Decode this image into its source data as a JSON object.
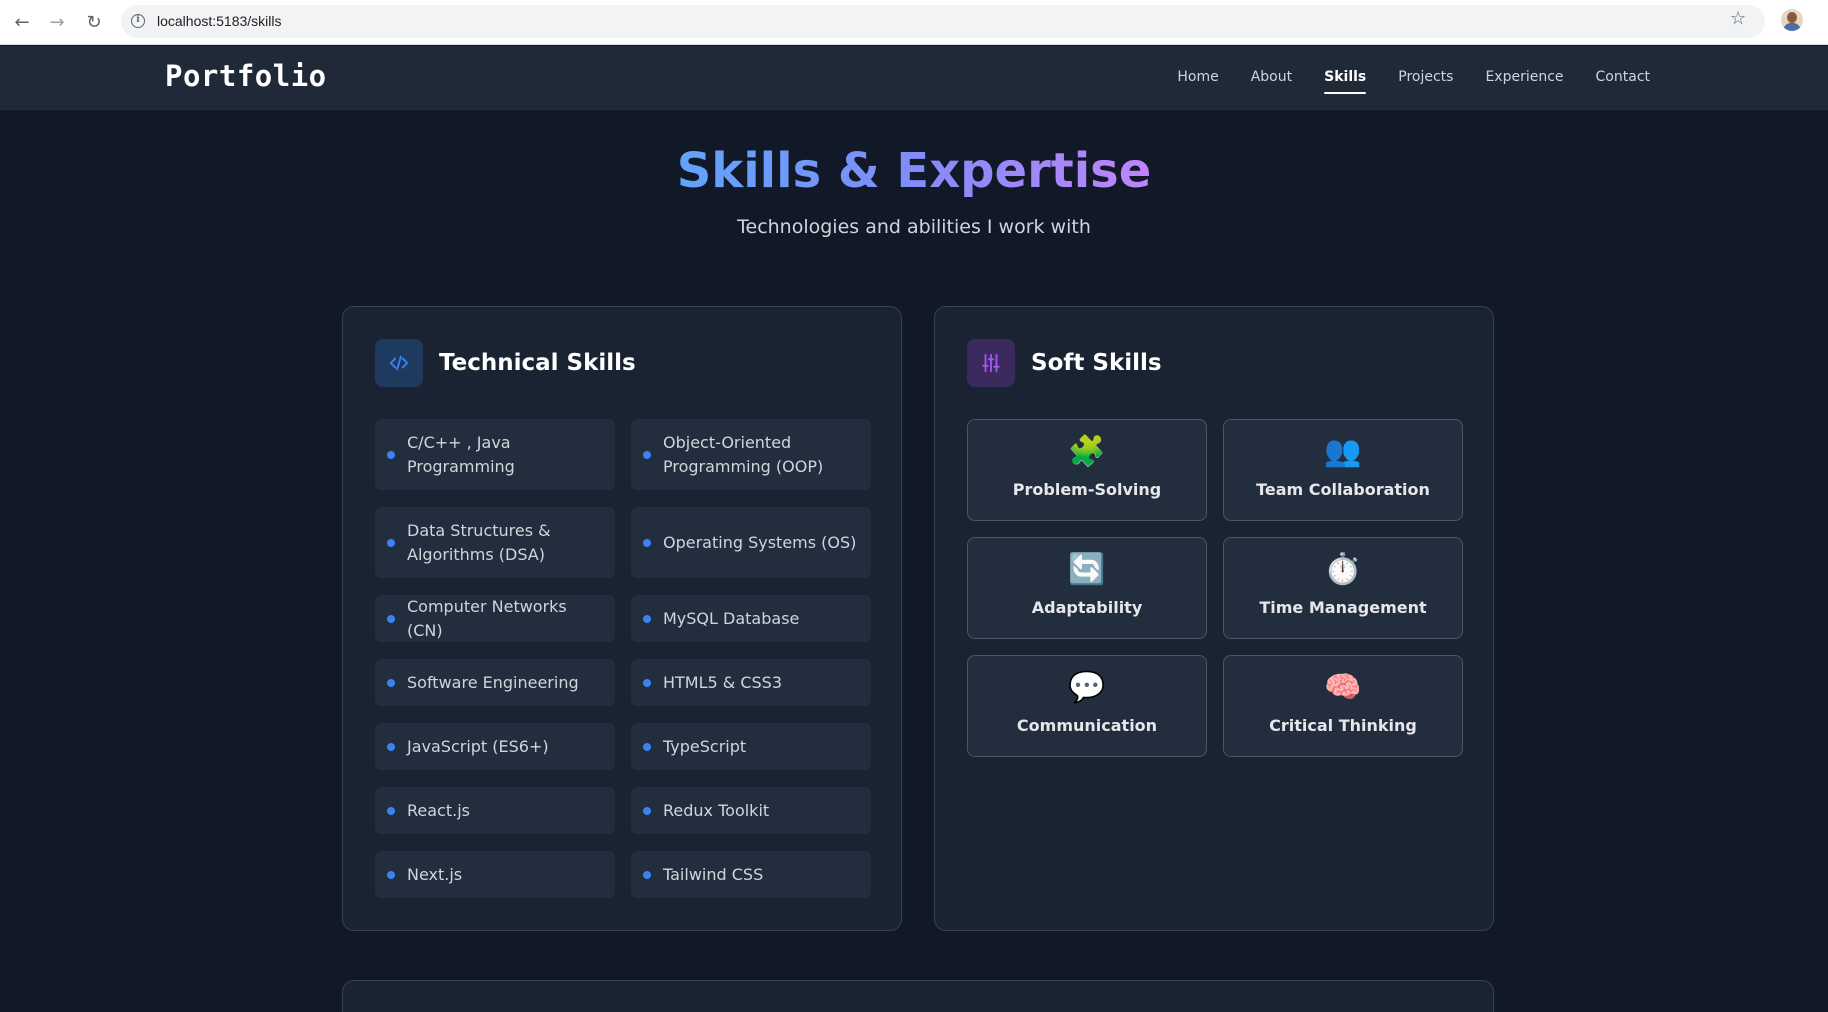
{
  "browser": {
    "url": "localhost:5183/skills"
  },
  "site": {
    "logo": "Portfolio",
    "nav": [
      {
        "label": "Home",
        "active": false
      },
      {
        "label": "About",
        "active": false
      },
      {
        "label": "Skills",
        "active": true
      },
      {
        "label": "Projects",
        "active": false
      },
      {
        "label": "Experience",
        "active": false
      },
      {
        "label": "Contact",
        "active": false
      }
    ]
  },
  "hero": {
    "title": "Skills & Expertise",
    "subtitle": "Technologies and abilities I work with"
  },
  "technical": {
    "title": "Technical Skills",
    "icon": "code-icon",
    "accent": "#3b82f6",
    "items": [
      "C/C++ , Java Programming",
      "Object-Oriented Programming (OOP)",
      "Data Structures & Algorithms (DSA)",
      "Operating Systems (OS)",
      "Computer Networks (CN)",
      "MySQL Database",
      "Software Engineering",
      "HTML5 & CSS3",
      "JavaScript (ES6+)",
      "TypeScript",
      "React.js",
      "Redux Toolkit",
      "Next.js",
      "Tailwind CSS"
    ]
  },
  "soft": {
    "title": "Soft Skills",
    "icon": "sliders-icon",
    "accent": "#a855f7",
    "items": [
      {
        "emoji": "🧩",
        "icon": "puzzle-icon",
        "label": "Problem-Solving"
      },
      {
        "emoji": "👥",
        "icon": "people-icon",
        "label": "Team Collaboration"
      },
      {
        "emoji": "🔄",
        "icon": "cycle-icon",
        "label": "Adaptability"
      },
      {
        "emoji": "⏱️",
        "icon": "stopwatch-icon",
        "label": "Time Management"
      },
      {
        "emoji": "💬",
        "icon": "speech-bubble-icon",
        "label": "Communication"
      },
      {
        "emoji": "🧠",
        "icon": "brain-icon",
        "label": "Critical Thinking"
      }
    ]
  }
}
